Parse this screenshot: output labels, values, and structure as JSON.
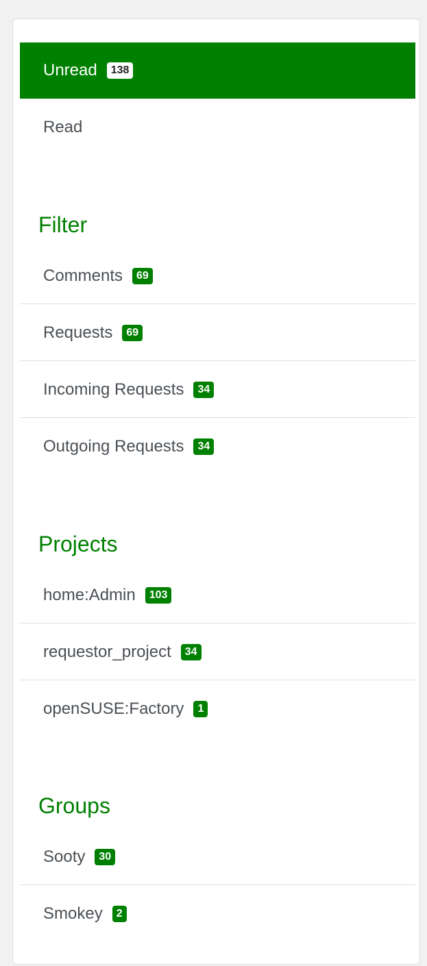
{
  "status": {
    "items": [
      {
        "label": "Unread",
        "count": "138"
      },
      {
        "label": "Read"
      }
    ]
  },
  "filter": {
    "heading": "Filter",
    "items": [
      {
        "label": "Comments",
        "count": "69"
      },
      {
        "label": "Requests",
        "count": "69"
      },
      {
        "label": "Incoming Requests",
        "count": "34"
      },
      {
        "label": "Outgoing Requests",
        "count": "34"
      }
    ]
  },
  "projects": {
    "heading": "Projects",
    "items": [
      {
        "label": "home:Admin",
        "count": "103"
      },
      {
        "label": "requestor_project",
        "count": "34"
      },
      {
        "label": "openSUSE:Factory",
        "count": "1"
      }
    ]
  },
  "groups": {
    "heading": "Groups",
    "items": [
      {
        "label": "Sooty",
        "count": "30"
      },
      {
        "label": "Smokey",
        "count": "2"
      }
    ]
  },
  "colors": {
    "accent": "#008000",
    "text": "#4a4f54",
    "background": "#f1f1f1"
  }
}
